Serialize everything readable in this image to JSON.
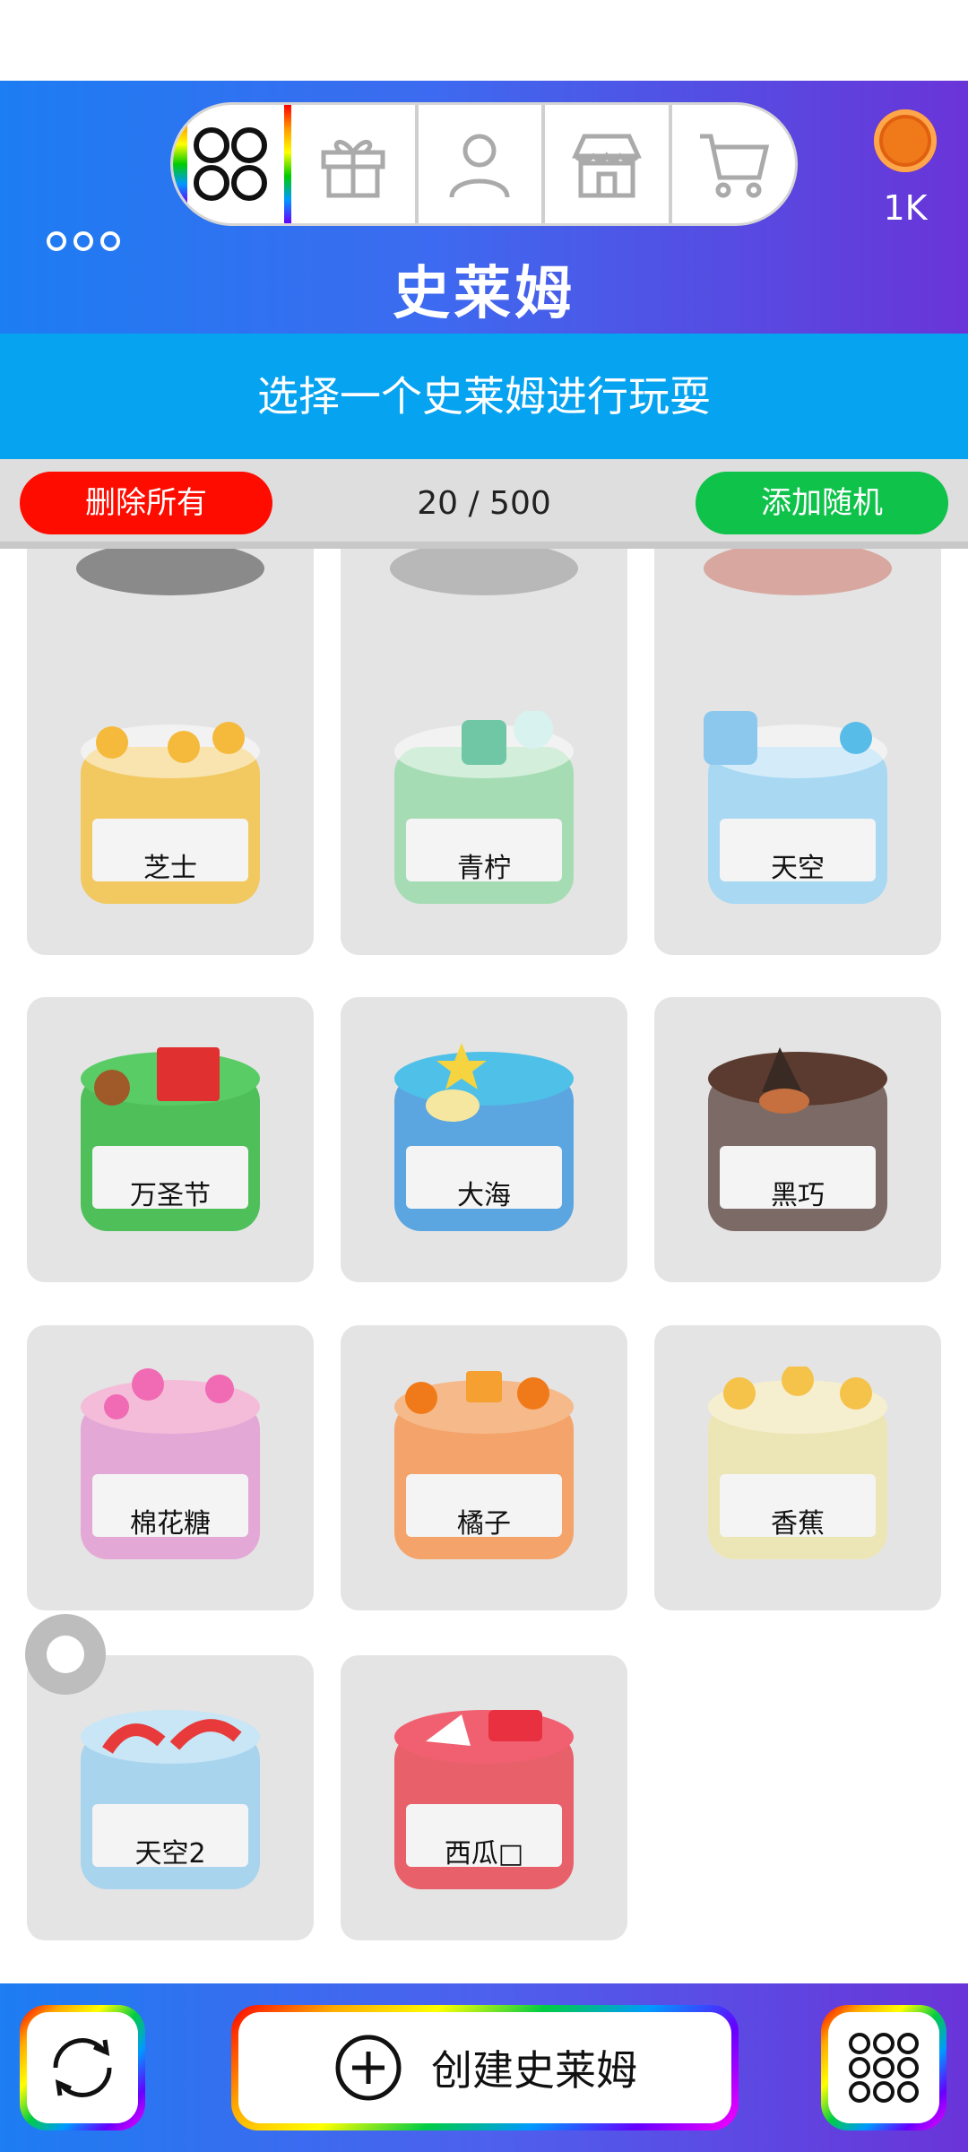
{
  "header": {
    "title": "史莱姆",
    "coins": "1K",
    "tabs": [
      "grid-icon",
      "gift-icon",
      "person-icon",
      "shop-icon",
      "cart-icon"
    ]
  },
  "subtitle": "选择一个史莱姆进行玩耍",
  "actions": {
    "delete_all": "删除所有",
    "count": "20 / 500",
    "add_random": "添加随机"
  },
  "slimes": [
    {
      "name": "芝士",
      "color": "#f2c960",
      "topping": "#f5b93c"
    },
    {
      "name": "青柠",
      "color": "#a6dcb4",
      "topping": "#6fc7a6"
    },
    {
      "name": "天空",
      "color": "#a8d8f2",
      "topping": "#58bce8"
    },
    {
      "name": "万圣节",
      "color": "#4fbf5a",
      "topping": "#e03030"
    },
    {
      "name": "大海",
      "color": "#5ba6e0",
      "topping": "#f5d440"
    },
    {
      "name": "黑巧",
      "color": "#7c6a66",
      "topping": "#5b3b2f"
    },
    {
      "name": "棉花糖",
      "color": "#f2b4d8",
      "topping": "#f06ab4"
    },
    {
      "name": "橘子",
      "color": "#f4a36a",
      "topping": "#f07a1a"
    },
    {
      "name": "香蕉",
      "color": "#f2ecc0",
      "topping": "#f5c24a"
    },
    {
      "name": "天空2",
      "color": "#a9d4ee",
      "topping": "#e83a3a"
    },
    {
      "name": "西瓜□",
      "color": "#e8606a",
      "topping": "#e83040"
    }
  ],
  "footer": {
    "create_label": "创建史莱姆"
  }
}
